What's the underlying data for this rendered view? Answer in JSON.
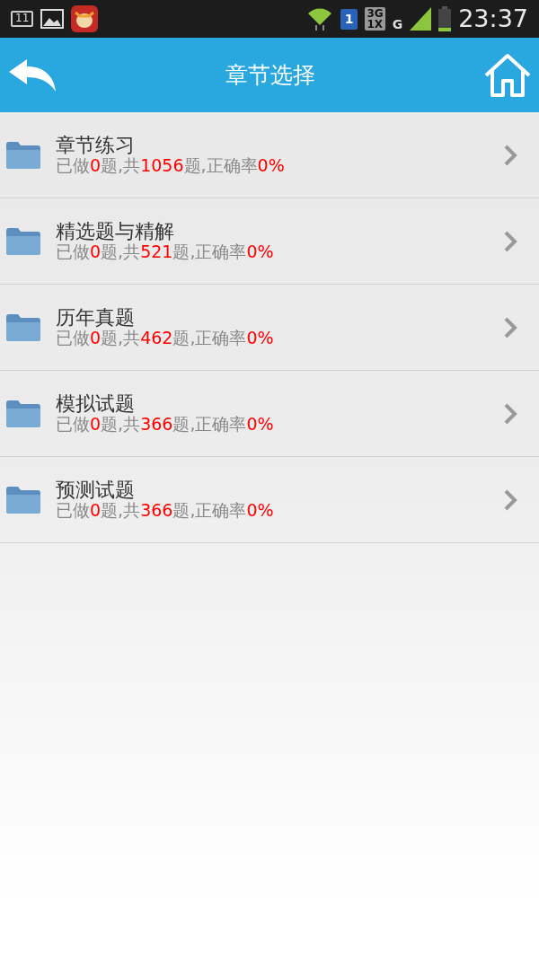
{
  "status_bar": {
    "notification_count": "11",
    "sim_slot": "1",
    "network_top": "3G",
    "network_bottom": "1X",
    "network_2": "G",
    "time": "23:37"
  },
  "header": {
    "title": "章节选择"
  },
  "chapters": [
    {
      "title": "章节练习",
      "stats": [
        {
          "kind": "plain",
          "text": "已做"
        },
        {
          "kind": "value",
          "text": "0"
        },
        {
          "kind": "plain",
          "text": "题,共"
        },
        {
          "kind": "value",
          "text": "1056"
        },
        {
          "kind": "plain",
          "text": "题,正确率"
        },
        {
          "kind": "value",
          "text": "0%"
        }
      ]
    },
    {
      "title": "精选题与精解",
      "stats": [
        {
          "kind": "plain",
          "text": "已做"
        },
        {
          "kind": "value",
          "text": "0"
        },
        {
          "kind": "plain",
          "text": "题,共"
        },
        {
          "kind": "value",
          "text": "521"
        },
        {
          "kind": "plain",
          "text": "题,正确率"
        },
        {
          "kind": "value",
          "text": "0%"
        }
      ]
    },
    {
      "title": "历年真题",
      "stats": [
        {
          "kind": "plain",
          "text": "已做"
        },
        {
          "kind": "value",
          "text": "0"
        },
        {
          "kind": "plain",
          "text": "题,共"
        },
        {
          "kind": "value",
          "text": "462"
        },
        {
          "kind": "plain",
          "text": "题,正确率"
        },
        {
          "kind": "value",
          "text": "0%"
        }
      ]
    },
    {
      "title": "模拟试题",
      "stats": [
        {
          "kind": "plain",
          "text": "已做"
        },
        {
          "kind": "value",
          "text": "0"
        },
        {
          "kind": "plain",
          "text": "题,共"
        },
        {
          "kind": "value",
          "text": "366"
        },
        {
          "kind": "plain",
          "text": "题,正确率"
        },
        {
          "kind": "value",
          "text": "0%"
        }
      ]
    },
    {
      "title": "预测试题",
      "stats": [
        {
          "kind": "plain",
          "text": "已做"
        },
        {
          "kind": "value",
          "text": "0"
        },
        {
          "kind": "plain",
          "text": "题,共"
        },
        {
          "kind": "value",
          "text": "366"
        },
        {
          "kind": "plain",
          "text": "题,正确率"
        },
        {
          "kind": "value",
          "text": "0%"
        }
      ]
    }
  ]
}
